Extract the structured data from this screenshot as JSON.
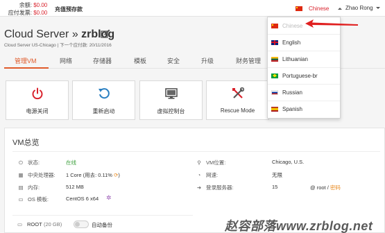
{
  "topbar": {
    "balance_label": "余额:",
    "balance_value": "$0.00",
    "due_label": "应付发票:",
    "due_value": "$0.00",
    "recharge_label": "充值预存款",
    "language": "Chinese",
    "user": "Zhao Rong"
  },
  "server": {
    "title_prefix": "Cloud Server »",
    "name": "zrblog",
    "subline": "Cloud Server US-Chicago  |  下一个应付款: 20/11/2016"
  },
  "tabs": [
    {
      "label": "管理VM",
      "active": true
    },
    {
      "label": "网络"
    },
    {
      "label": "存储器"
    },
    {
      "label": "模板"
    },
    {
      "label": "安全"
    },
    {
      "label": "升级"
    },
    {
      "label": "财务管理"
    }
  ],
  "actions": [
    {
      "label": "电源关闭",
      "icon": "power-icon",
      "color": "#d9232d"
    },
    {
      "label": "重新启动",
      "icon": "restart-icon",
      "color": "#2a7fc1"
    },
    {
      "label": "虚拟控制台",
      "icon": "monitor-icon",
      "color": "#555555"
    },
    {
      "label": "Rescue Mode",
      "icon": "tools-icon",
      "color": "#d9232d"
    }
  ],
  "vm": {
    "title": "VM总览",
    "status_label": "状态:",
    "status_value": "在线",
    "cpu_label": "中央处理器:",
    "cpu_value": "1 Core (用去: 0.11% ",
    "mem_label": "内存:",
    "mem_value": "512 MB",
    "os_label": "OS 模板:",
    "os_value": "CentOS 6 x64",
    "location_label": "VM位置:",
    "location_value": "Chicago, U.S.",
    "bandwidth_label": "网速:",
    "bandwidth_value": "无限",
    "login_label": "登录服务器:",
    "login_ip": "15",
    "login_user": "@ root / ",
    "login_password": "密码",
    "disk_label": "ROOT",
    "disk_size": "(20 GB)",
    "backup_label": "自动备份"
  },
  "languages": [
    {
      "label": "Chinese",
      "flag": "cn",
      "selected": true
    },
    {
      "label": "English",
      "flag": "gb"
    },
    {
      "label": "Lithuanian",
      "flag": "lt"
    },
    {
      "label": "Portuguese-br",
      "flag": "br"
    },
    {
      "label": "Russian",
      "flag": "ru"
    },
    {
      "label": "Spanish",
      "flag": "es"
    }
  ],
  "watermark": "赵容部落www.zrblog.net",
  "colors": {
    "accent": "#e05a2a",
    "danger": "#d9232d",
    "success": "#3c9f3c",
    "link": "#2a7fc1"
  }
}
